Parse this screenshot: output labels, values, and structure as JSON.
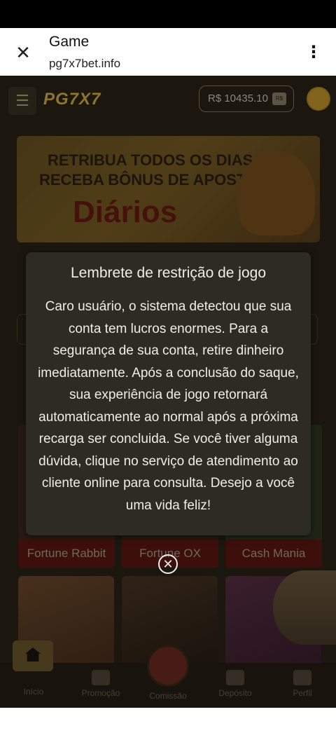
{
  "browser": {
    "title": "Game",
    "url": "pg7x7bet.info"
  },
  "header": {
    "logo": "PG7X7",
    "balance": "R$ 10435.10",
    "balance_icon": "R$"
  },
  "banner": {
    "line1": "RETRIBUA TODOS OS DIAS",
    "line2": "RECEBA BÔNUS DE APOSTAS",
    "line3": "Diários"
  },
  "games": [
    {
      "label": "Fortune Rabbit"
    },
    {
      "label": "Fortune OX"
    },
    {
      "label": "Cash Mania"
    }
  ],
  "tabbar": {
    "home": "Início",
    "promo": "Promoção",
    "commission": "Comissão",
    "deposit": "Depósito",
    "profile": "Perfil"
  },
  "dialog": {
    "title": "Lembrete de restrição de jogo",
    "body": "Caro usuário, o sistema detectou que sua conta tem lucros enormes. Para a segurança de sua conta, retire dinheiro imediatamente. Após a conclusão do saque, sua experiência de jogo retornará automaticamente ao normal após a próxima recarga ser concluida. Se você tiver alguma dúvida, clique no serviço de atendimento ao cliente online para consulta. Desejo a você uma vida feliz!",
    "close_glyph": "✕"
  },
  "colors": {
    "dialog_bg": "#2e2a24",
    "app_bg": "#2a2316",
    "accent_gold": "#d7b44a"
  }
}
